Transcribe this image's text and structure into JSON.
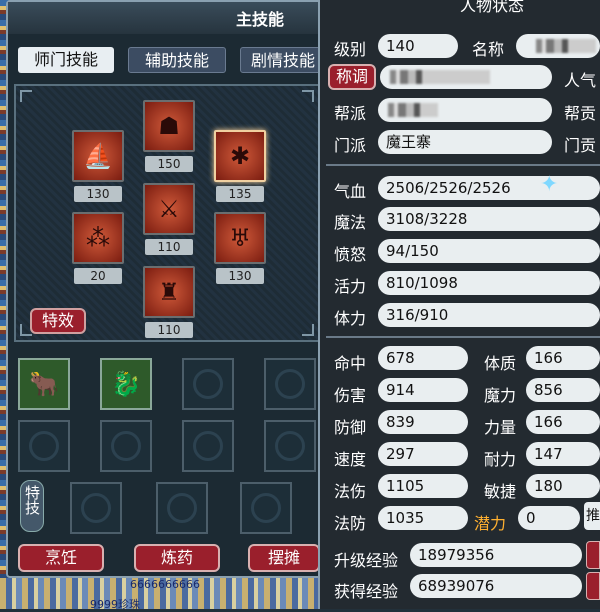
{
  "skill_panel": {
    "title": "主技能",
    "tabs": [
      "师门技能",
      "辅助技能",
      "剧情技能"
    ],
    "skill_levels": [
      "130",
      "150",
      "135",
      "20",
      "110",
      "130",
      "110"
    ],
    "effect_button": "特效",
    "special_label": "特技",
    "bottom_buttons": [
      "烹饪",
      "炼药",
      "摆摊"
    ]
  },
  "background": {
    "bottom_text": "6666666666",
    "bottom_text2": "9999珍珠"
  },
  "status_panel": {
    "title": "人物状态",
    "level_label": "级别",
    "level_value": "140",
    "name_label": "名称",
    "title_button": "称调",
    "popularity_label": "人气",
    "faction_label": "帮派",
    "contribution_label": "帮贡",
    "school_label": "门派",
    "school_value": "魔王寨",
    "school_contrib_label": "门贡",
    "hp_label": "气血",
    "hp_value": "2506/2526/2526",
    "mp_label": "魔法",
    "mp_value": "3108/3228",
    "anger_label": "愤怒",
    "anger_value": "94/150",
    "vitality_label": "活力",
    "vitality_value": "810/1098",
    "stamina_label": "体力",
    "stamina_value": "316/910",
    "hit_label": "命中",
    "hit_value": "678",
    "constitution_label": "体质",
    "constitution_value": "166",
    "damage_label": "伤害",
    "damage_value": "914",
    "magic_label": "魔力",
    "magic_value": "856",
    "defense_label": "防御",
    "defense_value": "839",
    "strength_label": "力量",
    "strength_value": "166",
    "speed_label": "速度",
    "speed_value": "297",
    "endurance_label": "耐力",
    "endurance_value": "147",
    "spell_dmg_label": "法伤",
    "spell_dmg_value": "1105",
    "agility_label": "敏捷",
    "agility_value": "180",
    "spell_def_label": "法防",
    "spell_def_value": "1035",
    "potential_label": "潜力",
    "potential_value": "0",
    "potential_button": "推",
    "upgrade_exp_label": "升级经验",
    "upgrade_exp_value": "18979356",
    "gained_exp_label": "获得经验",
    "gained_exp_value": "68939076"
  }
}
